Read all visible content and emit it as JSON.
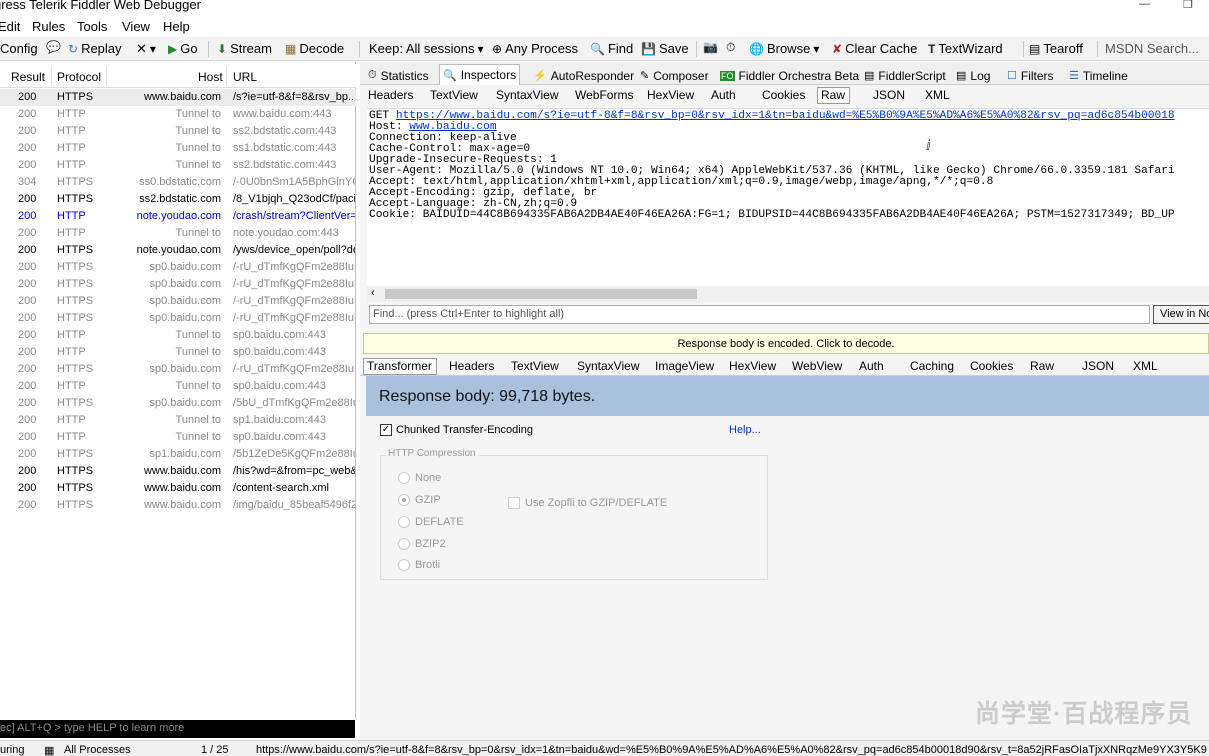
{
  "window": {
    "title": "gress Telerik Fiddler Web Debugger"
  },
  "menu": [
    "Edit",
    "Rules",
    "Tools",
    "View",
    "Help"
  ],
  "toolbar": {
    "config": "Config",
    "replay": "Replay",
    "remove": "✕",
    "go": "Go",
    "stream": "Stream",
    "decode": "Decode",
    "keep": "Keep: All sessions",
    "process": "Any Process",
    "find": "Find",
    "save": "Save",
    "browse": "Browse",
    "clear_cache": "Clear Cache",
    "textwizard": "TextWizard",
    "tearoff": "Tearoff",
    "msdn": "MSDN Search..."
  },
  "sessions": {
    "headers": {
      "result": "Result",
      "protocol": "Protocol",
      "host": "Host",
      "url": "URL"
    },
    "rows": [
      {
        "result": "200",
        "protocol": "HTTPS",
        "host": "www.baidu.com",
        "url": "/s?ie=utf-8&f=8&rsv_bp..."
      },
      {
        "result": "200",
        "protocol": "HTTP",
        "host": "Tunnel to",
        "url": "www.baidu.com:443"
      },
      {
        "result": "200",
        "protocol": "HTTP",
        "host": "Tunnel to",
        "url": "ss2.bdstatic.com:443"
      },
      {
        "result": "200",
        "protocol": "HTTP",
        "host": "Tunnel to",
        "url": "ss1.bdstatic.com:443"
      },
      {
        "result": "200",
        "protocol": "HTTP",
        "host": "Tunnel to",
        "url": "ss2.bdstatic.com:443"
      },
      {
        "result": "304",
        "protocol": "HTTPS",
        "host": "ss0.bdstatic.com",
        "url": "/-0U0bnSm1A5BphGlnYG/"
      },
      {
        "result": "200",
        "protocol": "HTTPS",
        "host": "ss2.bdstatic.com",
        "url": "/8_V1bjqh_Q23odCf/pacific"
      },
      {
        "result": "200",
        "protocol": "HTTP",
        "host": "note.youdao.com",
        "url": "/crash/stream?ClientVer="
      },
      {
        "result": "200",
        "protocol": "HTTP",
        "host": "Tunnel to",
        "url": "note.youdao.com:443"
      },
      {
        "result": "200",
        "protocol": "HTTPS",
        "host": "note.youdao.com",
        "url": "/yws/device_open/poll?de"
      },
      {
        "result": "200",
        "protocol": "HTTPS",
        "host": "sp0.baidu.com",
        "url": "/-rU_dTmfKgQFm2e88IuM"
      },
      {
        "result": "200",
        "protocol": "HTTPS",
        "host": "sp0.baidu.com",
        "url": "/-rU_dTmfKgQFm2e88IuM"
      },
      {
        "result": "200",
        "protocol": "HTTPS",
        "host": "sp0.baidu.com",
        "url": "/-rU_dTmfKgQFm2e88IuM"
      },
      {
        "result": "200",
        "protocol": "HTTPS",
        "host": "sp0.baidu.com",
        "url": "/-rU_dTmfKgQFm2e88IuM"
      },
      {
        "result": "200",
        "protocol": "HTTP",
        "host": "Tunnel to",
        "url": "sp0.baidu.com:443"
      },
      {
        "result": "200",
        "protocol": "HTTP",
        "host": "Tunnel to",
        "url": "sp0.baidu.com:443"
      },
      {
        "result": "200",
        "protocol": "HTTPS",
        "host": "sp0.baidu.com",
        "url": "/-rU_dTmfKgQFm2e88IuM"
      },
      {
        "result": "200",
        "protocol": "HTTP",
        "host": "Tunnel to",
        "url": "sp0.baidu.com:443"
      },
      {
        "result": "200",
        "protocol": "HTTPS",
        "host": "sp0.baidu.com",
        "url": "/5bU_dTmfKgQFm2e88Iu"
      },
      {
        "result": "200",
        "protocol": "HTTP",
        "host": "Tunnel to",
        "url": "sp1.baidu.com:443"
      },
      {
        "result": "200",
        "protocol": "HTTP",
        "host": "Tunnel to",
        "url": "sp0.baidu.com:443"
      },
      {
        "result": "200",
        "protocol": "HTTPS",
        "host": "sp1.baidu.com",
        "url": "/5b1ZeDe5KgQFm2e88Iu"
      },
      {
        "result": "200",
        "protocol": "HTTPS",
        "host": "www.baidu.com",
        "url": "/his?wd=&from=pc_web&"
      },
      {
        "result": "200",
        "protocol": "HTTPS",
        "host": "www.baidu.com",
        "url": "/content-search.xml"
      },
      {
        "result": "200",
        "protocol": "HTTPS",
        "host": "www.baidu.com",
        "url": "/img/baidu_85beaf5496f2"
      }
    ]
  },
  "quickexec": {
    "text": "ec] ALT+Q > type HELP to learn more"
  },
  "status": {
    "capturing": "uring",
    "processes": "All Processes",
    "count": "1 / 25",
    "url": "https://www.baidu.com/s?ie=utf-8&f=8&rsv_bp=0&rsv_idx=1&tn=baidu&wd=%E5%B0%9A%E5%AD%A6%E5%A0%82&rsv_pq=ad6c854b00018d90&rsv_t=8a52jRFasOIaTjxXNRqzMe9YX3Y5K9"
  },
  "main_tabs": [
    "Statistics",
    "Inspectors",
    "AutoResponder",
    "Composer",
    "Fiddler Orchestra Beta",
    "FiddlerScript",
    "Log",
    "Filters",
    "Timeline"
  ],
  "request_tabs": [
    "Headers",
    "TextView",
    "SyntaxView",
    "WebForms",
    "HexView",
    "Auth",
    "Cookies",
    "Raw",
    "JSON",
    "XML"
  ],
  "request_raw": {
    "method": "GET ",
    "url": "https://www.baidu.com/s?ie=utf-8&f=8&rsv_bp=0&rsv_idx=1&tn=baidu&wd=%E5%B0%9A%E5%AD%A6%E5%A0%82&rsv_pq=ad6c854b00018",
    "host_label": "Host: ",
    "host": "www.baidu.com",
    "lines": "Connection: keep-alive\nCache-Control: max-age=0\nUpgrade-Insecure-Requests: 1\nUser-Agent: Mozilla/5.0 (Windows NT 10.0; Win64; x64) AppleWebKit/537.36 (KHTML, like Gecko) Chrome/66.0.3359.181 Safari\nAccept: text/html,application/xhtml+xml,application/xml;q=0.9,image/webp,image/apng,*/*;q=0.8\nAccept-Encoding: gzip, deflate, br\nAccept-Language: zh-CN,zh;q=0.9\nCookie: BAIDUID=44C8B694335FAB6A2DB4AE40F46EA26A:FG=1; BIDUPSID=44C8B694335FAB6A2DB4AE40F46EA26A; PSTM=1527317349; BD_UP"
  },
  "find": {
    "placeholder": "Find... (press Ctrl+Enter to highlight all)",
    "view_in": "View in No"
  },
  "encoded_notice": "Response body is encoded. Click to decode.",
  "response_tabs": [
    "Transformer",
    "Headers",
    "TextView",
    "SyntaxView",
    "ImageView",
    "HexView",
    "WebView",
    "Auth",
    "Caching",
    "Cookies",
    "Raw",
    "JSON",
    "XML"
  ],
  "transformer": {
    "body_size": "Response body: 99,718 bytes.",
    "chunked": "Chunked Transfer-Encoding",
    "help": "Help...",
    "compression_title": "HTTP Compression",
    "options": [
      "None",
      "GZIP",
      "DEFLATE",
      "BZIP2",
      "Brotli"
    ],
    "zopfli": "Use Zopfli to GZIP/DEFLATE"
  },
  "watermark": "尚学堂·百战程序员"
}
